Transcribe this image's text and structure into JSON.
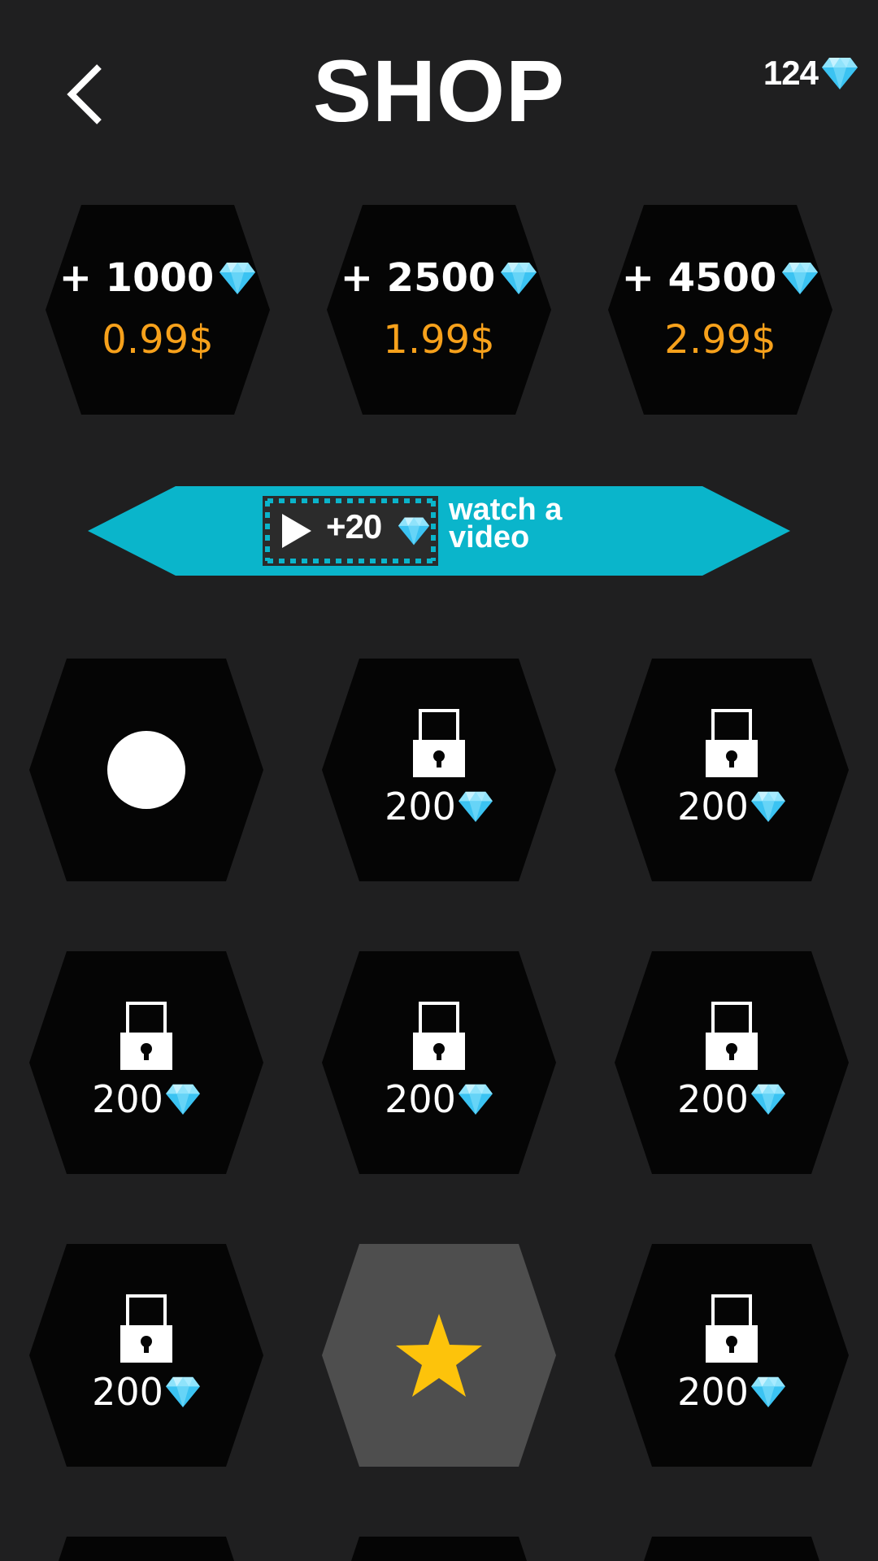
{
  "header": {
    "title": "SHOP",
    "balance": "124",
    "back_icon": "chevron-left-icon",
    "currency_icon": "diamond-icon"
  },
  "gem_packs": [
    {
      "amount": "+ 1000",
      "price": "0.99$"
    },
    {
      "amount": "+ 2500",
      "price": "1.99$"
    },
    {
      "amount": "+ 4500",
      "price": "2.99$"
    }
  ],
  "video_offer": {
    "reward": "+20",
    "label_line1": "watch a",
    "label_line2": "video",
    "icon": "play-icon"
  },
  "items": [
    {
      "state": "selected",
      "icon": "circle-icon",
      "cost": ""
    },
    {
      "state": "locked",
      "icon": "lock-icon",
      "cost": "200"
    },
    {
      "state": "locked",
      "icon": "lock-icon",
      "cost": "200"
    },
    {
      "state": "locked",
      "icon": "lock-icon",
      "cost": "200"
    },
    {
      "state": "locked",
      "icon": "lock-icon",
      "cost": "200"
    },
    {
      "state": "locked",
      "icon": "lock-icon",
      "cost": "200"
    },
    {
      "state": "locked",
      "icon": "lock-icon",
      "cost": "200"
    },
    {
      "state": "owned",
      "icon": "star-icon",
      "cost": ""
    },
    {
      "state": "locked",
      "icon": "lock-icon",
      "cost": "200"
    }
  ],
  "colors": {
    "background": "#1f1f20",
    "hex": "#050505",
    "hex_highlight": "#4e4e4e",
    "price": "#f7a11b",
    "banner": "#0ab5cb",
    "diamond": "#4fd0f5",
    "star": "#fdc30b"
  }
}
